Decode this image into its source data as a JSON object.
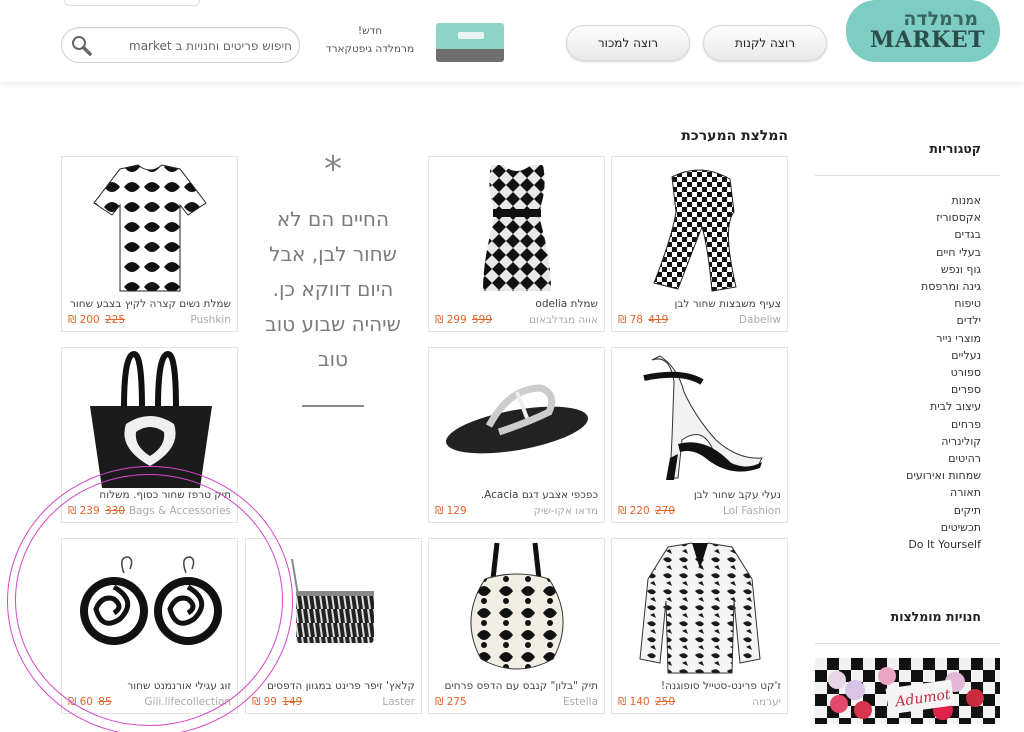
{
  "header": {
    "logo_hebrew": "מרמלדה",
    "logo_english": "MARKET",
    "buy_button": "רוצה לקנות",
    "sell_button": "רוצה למכור",
    "giftcard_new": "חדש!",
    "giftcard_label": "מרמלדה גיפטקארד",
    "search_placeholder": "חיפוש פריטים וחנויות ב market"
  },
  "sidebar": {
    "categories_title": "קטגוריות",
    "categories": [
      "אמנות",
      "אקססוריז",
      "בגדים",
      "בעלי חיים",
      "גוף ונפש",
      "גינה ומרפסת",
      "טיפוח",
      "ילדים",
      "מוצרי נייר",
      "נעליים",
      "ספורט",
      "ספרים",
      "עיצוב לבית",
      "פרחים",
      "קולינריה",
      "רהיטים",
      "שמחות ואירועים",
      "תאורה",
      "תיקים",
      "תכשיטים",
      "Do It Yourself"
    ],
    "stores_title": "חנויות מומלצות",
    "store_image_text": "Adumot"
  },
  "main": {
    "section_title": "המלצת המערכת",
    "quote": {
      "star": "*",
      "text": "החיים הם לא שחור לבן, אבל היום דווקא כן. שיהיה שבוע טוב טוב"
    },
    "currency": "₪",
    "products": [
      {
        "title": "צעיף משבצות שחור לבן",
        "brand": "Dabeliw",
        "price": "78",
        "old_price": "419"
      },
      {
        "title": "שמלת odelia",
        "brand": "אווה מגדלבאום",
        "price": "299",
        "old_price": "599"
      },
      {
        "title": "שמלת נשים קצרה לקיץ בצבע שחור",
        "brand": "Pushkin",
        "price": "200",
        "old_price": "225"
      },
      {
        "title": "נעלי עקב שחור לבן",
        "brand": "Lol Fashion",
        "price": "220",
        "old_price": "270"
      },
      {
        "title": "כפכפי אצבע דגם Acacia.",
        "brand": "מדאו אקו-שיק",
        "price": "129",
        "old_price": ""
      },
      {
        "title": "תיק טרפז שחור כסוף. משלוח",
        "brand": "Bags & Accessories",
        "price": "239",
        "old_price": "330"
      },
      {
        "title": "ז'קט פרינט-סטייל סופוגנה!",
        "brand": "יערמה",
        "price": "140",
        "old_price": "250"
      },
      {
        "title": "תיק \"בלון\" קנבס עם הדפס פרחים",
        "brand": "Estella",
        "price": "275",
        "old_price": ""
      },
      {
        "title": "קלאץ' זיפר פרינט במגוון הדפסים",
        "brand": "Laster",
        "price": "99",
        "old_price": "149"
      },
      {
        "title": "זוג עגילי אורנמנט שחור",
        "brand": "Gili.lifecollection",
        "price": "60",
        "old_price": "85"
      }
    ]
  },
  "colors": {
    "logo_bg": "#7dcdc3",
    "price": "#e0662b",
    "annotation_circle": "#d648c9"
  }
}
